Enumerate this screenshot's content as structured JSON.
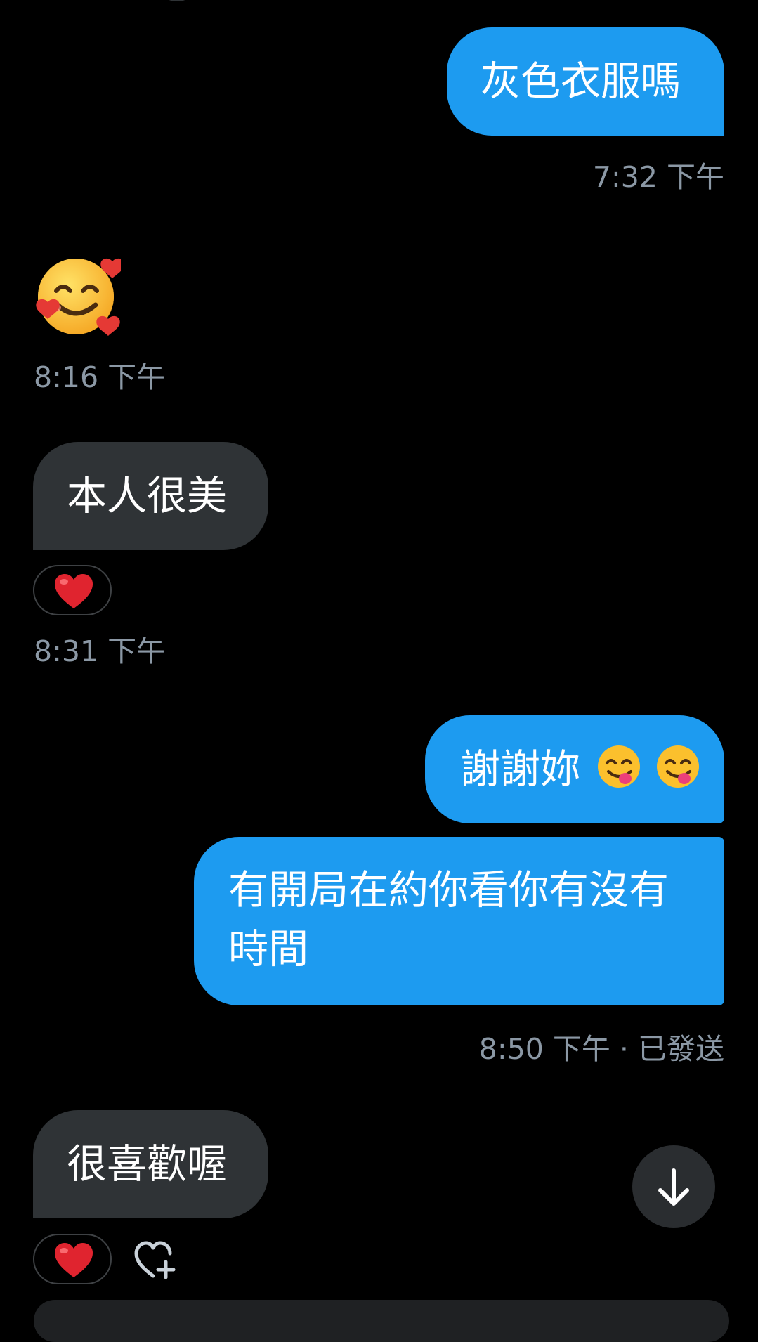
{
  "messages": [
    {
      "id": "m1",
      "direction": "sent",
      "text": "灰色衣服嗎",
      "time": "7:32 下午"
    },
    {
      "id": "m2",
      "direction": "received",
      "emoji": "smiling-face-with-hearts",
      "time": "8:16 下午"
    },
    {
      "id": "m3",
      "direction": "received",
      "text": "本人很美",
      "reaction": "heart",
      "time": "8:31 下午"
    },
    {
      "id": "m4",
      "direction": "sent",
      "text": "謝謝妳"
    },
    {
      "id": "m5",
      "direction": "sent",
      "text_line1": "有開局在約你看你有沒有",
      "text_line2": "時間",
      "time": "8:50 下午 · 已發送"
    },
    {
      "id": "m6",
      "direction": "received",
      "text": "很喜歡喔",
      "reaction": "heart"
    }
  ],
  "icons": {
    "reaction": "red-heart-icon",
    "add_reaction": "heart-plus-icon",
    "scroll": "arrow-down-icon",
    "yum": "face-savoring-food-icon"
  },
  "colors": {
    "sent_bubble": "#1d9bf0",
    "received_bubble": "#2f3336",
    "timestamp": "#8b98a5",
    "background": "#000000"
  }
}
